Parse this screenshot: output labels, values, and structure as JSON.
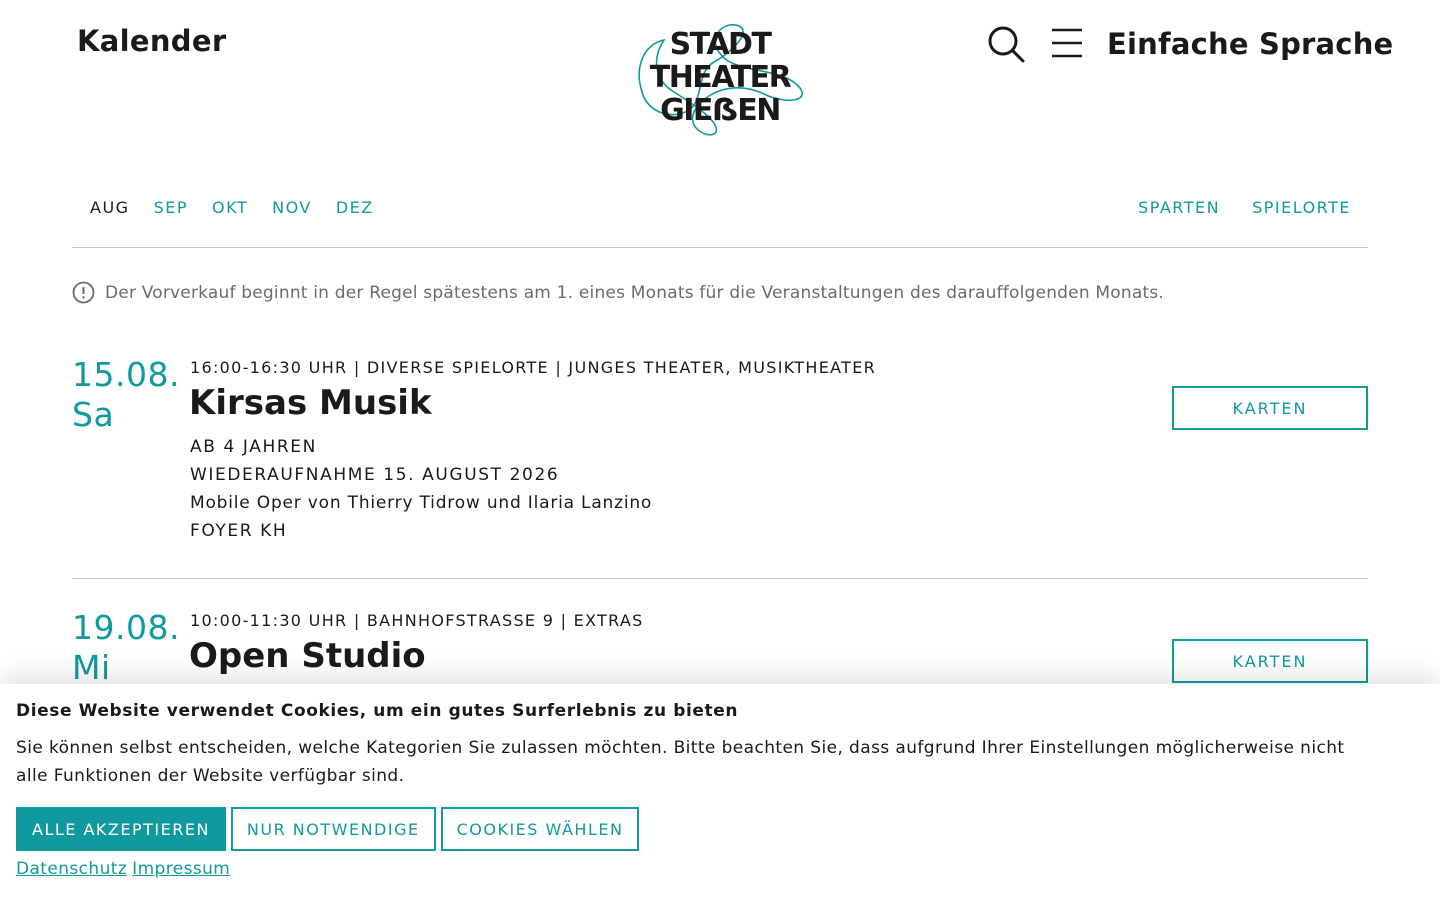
{
  "header": {
    "page_title": "Kalender",
    "logo_lines": [
      "STADT",
      "THEATER",
      "GIEẞEN"
    ],
    "search_icon": "search-icon",
    "menu_icon": "hamburger-menu-icon",
    "language_label": "Einfache Sprache"
  },
  "filterbar": {
    "months": [
      "AUG",
      "SEP",
      "OKT",
      "NOV",
      "DEZ"
    ],
    "active_month": "AUG",
    "filters": [
      "SPARTEN",
      "SPIELORTE"
    ]
  },
  "notice": {
    "icon": "info-circle-icon",
    "text": "Der Vorverkauf beginnt in der Regel spätestens am 1. eines Monats für die Veranstaltungen des darauffolgenden Monats."
  },
  "events": [
    {
      "date": "15.08.",
      "weekday": "Sa",
      "meta": "16:00-16:30 UHR | DIVERSE SPIELORTE | JUNGES THEATER, MUSIKTHEATER",
      "title": "Kirsas Musik",
      "age": "AB 4 JAHREN",
      "revival": "WIEDERAUFNAHME 15. AUGUST 2026",
      "description": "Mobile Oper von Thierry Tidrow und Ilaria Lanzino",
      "venue": "FOYER KH",
      "button": "KARTEN"
    },
    {
      "date": "19.08.",
      "weekday": "Mi",
      "meta": "10:00-11:30 UHR | BAHNHOFSTRASSE 9 | EXTRAS",
      "title": "Open Studio",
      "button": "KARTEN"
    }
  ],
  "cookie_banner": {
    "title": "Diese Website verwendet Cookies, um ein gutes Surferlebnis zu bieten",
    "text": "Sie können selbst entscheiden, welche Kategorien Sie zulassen möchten. Bitte beachten Sie, dass aufgrund Ihrer Einstellungen möglicherweise nicht alle Funktionen der Website verfügbar sind.",
    "accept_all": "ALLE AKZEPTIEREN",
    "necessary_only": "NUR NOTWENDIGE",
    "choose": "COOKIES WÄHLEN",
    "privacy_link": "Datenschutz",
    "imprint_link": "Impressum"
  },
  "colors": {
    "accent": "#10999e",
    "text": "#1a1a1a",
    "muted": "#6b6b6b",
    "divider": "#c8c8c8"
  }
}
